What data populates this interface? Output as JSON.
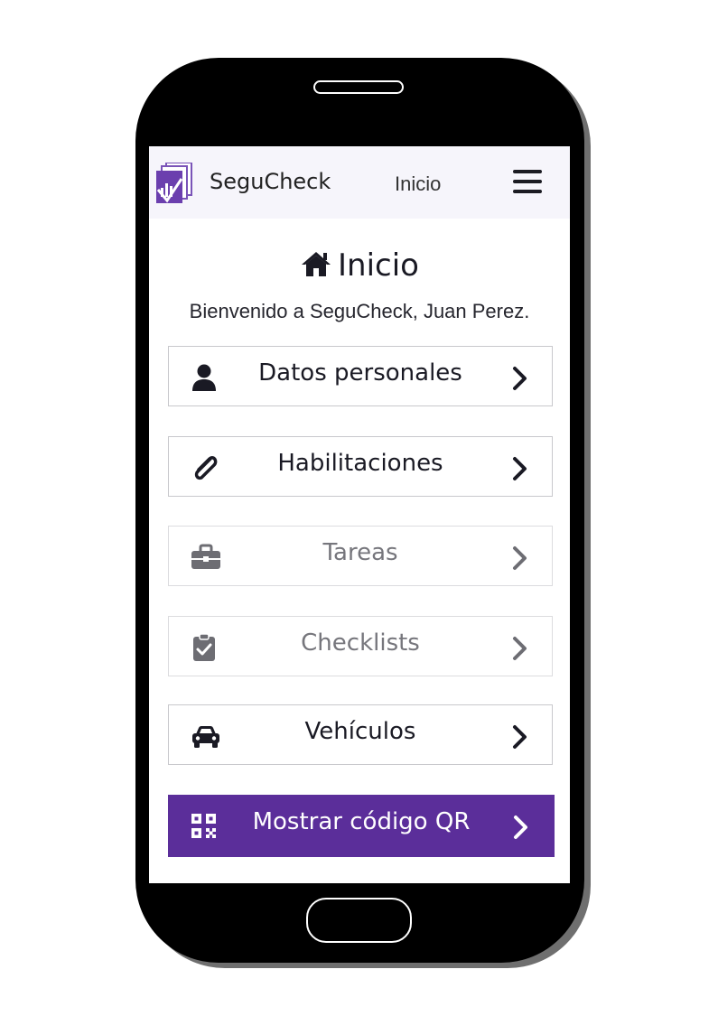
{
  "navbar": {
    "brand": "SeguCheck",
    "nav_link": "Inicio",
    "logo_icon": "segucheck-logo-icon",
    "menu_icon": "hamburger-menu-icon"
  },
  "page": {
    "heading": "Inicio",
    "heading_icon": "home-icon",
    "welcome": "Bienvenido a SeguCheck, Juan Perez."
  },
  "menu": {
    "items": [
      {
        "label": "Datos personales",
        "icon": "user-icon",
        "enabled": true
      },
      {
        "label": "Habilitaciones",
        "icon": "paperclip-icon",
        "enabled": true
      },
      {
        "label": "Tareas",
        "icon": "briefcase-icon",
        "enabled": false
      },
      {
        "label": "Checklists",
        "icon": "clipboard-check-icon",
        "enabled": false
      },
      {
        "label": "Vehículos",
        "icon": "car-icon",
        "enabled": true
      }
    ],
    "qr_button": {
      "label": "Mostrar código QR",
      "icon": "qrcode-icon"
    }
  },
  "colors": {
    "accent": "#5b2e9a",
    "navbar_bg": "#f6f5fb",
    "text_dark": "#1a1a24",
    "text_disabled": "#76767c",
    "phone_body": "#000000"
  }
}
